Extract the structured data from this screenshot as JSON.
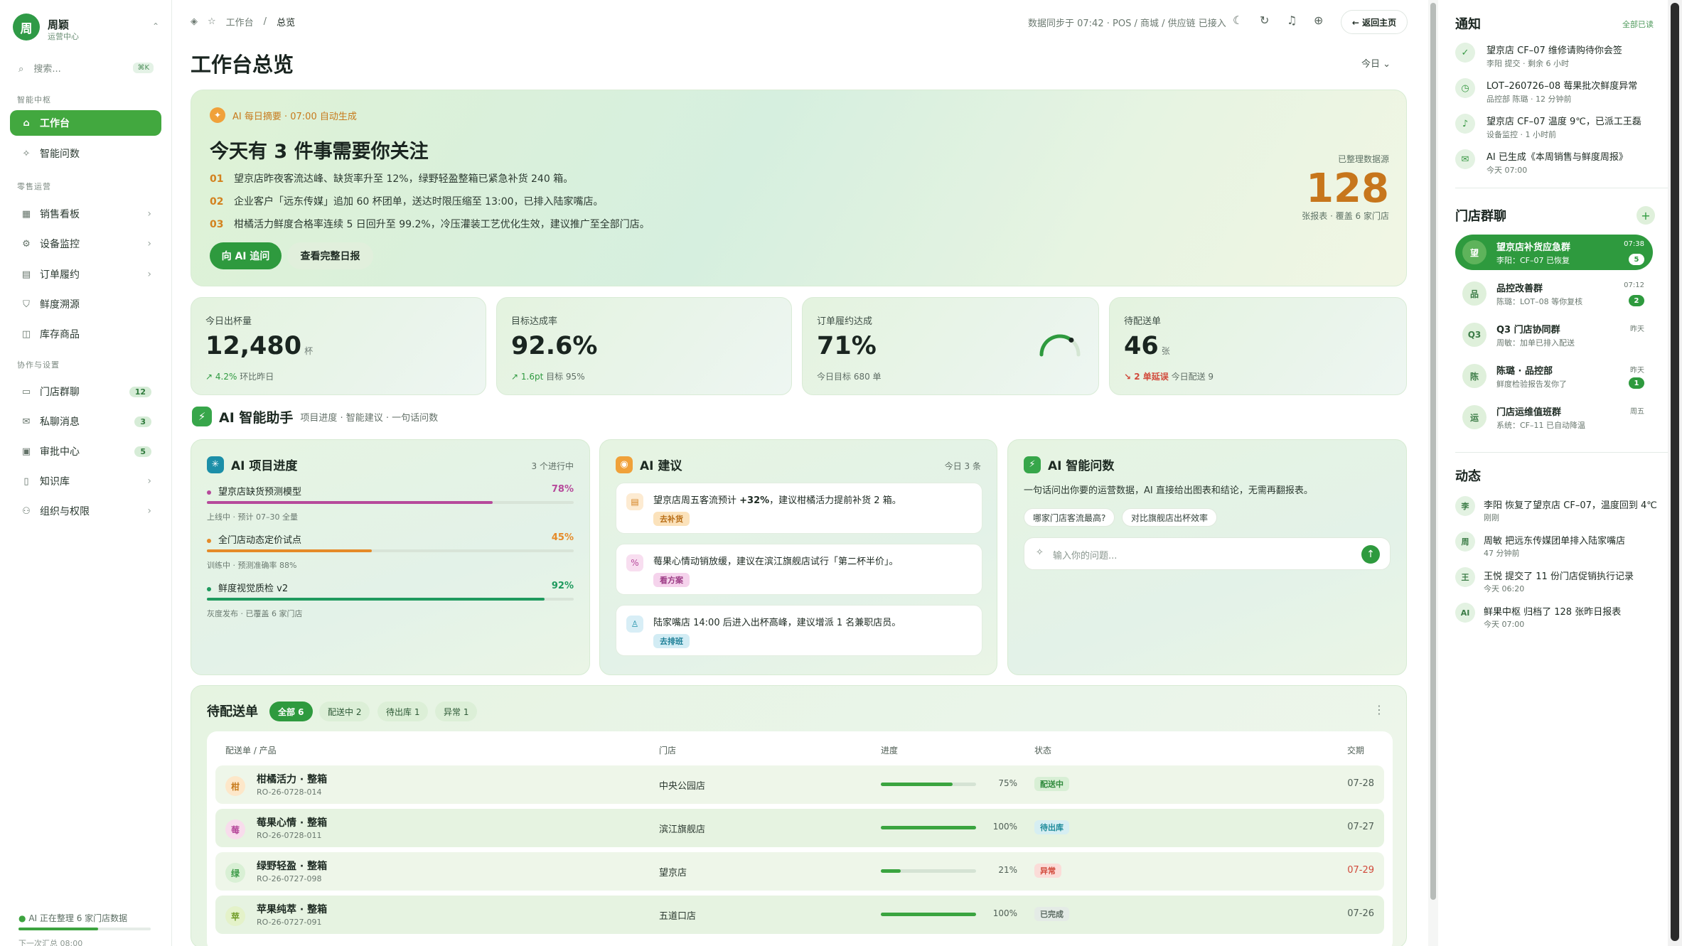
{
  "brand": {
    "avatar": "周",
    "name": "周颖",
    "role": "运营中心"
  },
  "search": {
    "placeholder": "搜索...",
    "shortcut": "⌘K"
  },
  "sections": {
    "smart": "智能中枢",
    "retail": "零售运营",
    "collab": "协作与设置"
  },
  "nav": [
    {
      "label": "工作台",
      "icon": "home-icon",
      "active": true
    },
    {
      "label": "智能问数",
      "icon": "sparkle-icon"
    },
    {
      "label": "销售看板",
      "icon": "board-icon",
      "chevron": true
    },
    {
      "label": "设备监控",
      "icon": "device-icon",
      "chevron": true
    },
    {
      "label": "订单履约",
      "icon": "receipt-icon",
      "chevron": true
    },
    {
      "label": "鲜度溯源",
      "icon": "shield-icon"
    },
    {
      "label": "库存商品",
      "icon": "box-icon"
    },
    {
      "label": "门店群聊",
      "icon": "chat-icon",
      "badge": "12"
    },
    {
      "label": "私聊消息",
      "icon": "mail-icon",
      "badge": "3"
    },
    {
      "label": "审批中心",
      "icon": "clipboard-icon",
      "badge": "5"
    },
    {
      "label": "知识库",
      "icon": "book-icon",
      "chevron": true
    },
    {
      "label": "组织与权限",
      "icon": "people-icon",
      "chevron": true
    }
  ],
  "sidebar_footer": {
    "status": "AI 正在整理 6 家门店数据",
    "sub": "下一次汇总 08:00",
    "progress": 0.6
  },
  "breadcrumb": {
    "root": "工作台",
    "sep": "/",
    "current": "总览"
  },
  "topbar": {
    "sync": "数据同步于 07:42 · POS / 商城 / 供应链 已接入",
    "back": "← 返回主页"
  },
  "page_title": "工作台总览",
  "range": "今日  ⌄",
  "hero": {
    "tag": "AI 每日摘要 · 07:00 自动生成",
    "title": "今天有 3 件事需要你关注",
    "items": [
      {
        "n": "01",
        "text": "望京店昨夜客流达峰、缺货率升至 12%，绿野轻盈整箱已紧急补货 240 箱。"
      },
      {
        "n": "02",
        "text": "企业客户「远东传媒」追加 60 杯团单，送达时限压缩至 13:00，已排入陆家嘴店。"
      },
      {
        "n": "03",
        "text": "柑橘活力鲜度合格率连续 5 日回升至 99.2%，冷压灌装工艺优化生效，建议推广至全部门店。"
      }
    ],
    "btn_ask": "向 AI 追问",
    "btn_daily": "查看完整日报",
    "stat_label": "已整理数据源",
    "stat_value": "128",
    "stat_sub": "张报表 · 覆盖 6 家门店"
  },
  "kpis": [
    {
      "label": "今日出杯量",
      "value": "12,480",
      "unit": "杯",
      "trend": "↗ 4.2%",
      "trend_sub": "环比昨日"
    },
    {
      "label": "目标达成率",
      "value": "92.6%",
      "unit": "",
      "trend": "↗ 1.6pt",
      "trend_sub": "目标 95%"
    },
    {
      "label": "订单履约达成",
      "value": "71%",
      "unit": "",
      "trend": "",
      "trend_sub": "今日目标 680 单",
      "gauge": 0.71
    },
    {
      "label": "待配送单",
      "value": "46",
      "unit": "张",
      "trend": "↘ 2 单延误",
      "trend_sub": "今日配送 9"
    }
  ],
  "assistant": {
    "title": "AI 智能助手",
    "sub": "项目进度 · 智能建议 · 一句话问数"
  },
  "progress_card": {
    "title": "AI 项目进度",
    "tag": "3 个进行中",
    "items": [
      {
        "name": "望京店缺货预测模型",
        "pct": "78%",
        "value": 0.78,
        "color": "#b64a9b",
        "detail": "上线中 · 预计 07–30 全量"
      },
      {
        "name": "全门店动态定价试点",
        "pct": "45%",
        "value": 0.45,
        "color": "#e58a28",
        "detail": "训练中 · 预测准确率 88%"
      },
      {
        "name": "鲜度视觉质检 v2",
        "pct": "92%",
        "value": 0.92,
        "color": "#1f9a5e",
        "detail": "灰度发布 · 已覆盖 6 家门店"
      }
    ]
  },
  "suggest_card": {
    "title": "AI 建议",
    "tag": "今日 3 条",
    "items": [
      {
        "pre": "望京店周五客流预计 ",
        "strong": "+32%",
        "post": "，建议柑橘活力提前补货 2 箱。",
        "btn": "去补货",
        "icon": "box-icon",
        "glyph": "▤"
      },
      {
        "pre": "莓果心情动销放缓，建议在滨江旗舰店试行「第二杯半价」。",
        "strong": "",
        "post": "",
        "btn": "看方案",
        "icon": "percent-icon",
        "glyph": "%"
      },
      {
        "pre": "陆家嘴店 14:00 后进入出杯高峰，建议增派 1 名兼职店员。",
        "strong": "",
        "post": "",
        "btn": "去排班",
        "icon": "person-icon",
        "glyph": "♙"
      }
    ]
  },
  "qa_card": {
    "title": "AI 智能问数",
    "desc": "一句话问出你要的运营数据，AI 直接给出图表和结论，无需再翻报表。",
    "chips": [
      "哪家门店客流最高?",
      "对比旗舰店出杯效率"
    ],
    "placeholder": "输入你的问题..."
  },
  "orders": {
    "title": "待配送单",
    "filters": [
      "全部 6",
      "配送中 2",
      "待出库 1",
      "异常 1"
    ],
    "columns": {
      "product": "配送单 / 产品",
      "store": "门店",
      "progress": "进度",
      "status": "状态",
      "due": "交期"
    },
    "rows": [
      {
        "icon": "柑",
        "name": "柑橘活力 · 整箱",
        "id": "RO-26-0728-014",
        "store": "中央公园店",
        "pct": "75%",
        "value": 0.75,
        "status": "配送中",
        "due": "07-28"
      },
      {
        "icon": "莓",
        "name": "莓果心情 · 整箱",
        "id": "RO-26-0728-011",
        "store": "滨江旗舰店",
        "pct": "100%",
        "value": 1.0,
        "status": "待出库",
        "due": "07-27"
      },
      {
        "icon": "绿",
        "name": "绿野轻盈 · 整箱",
        "id": "RO-26-0727-098",
        "store": "望京店",
        "pct": "21%",
        "value": 0.21,
        "status": "异常",
        "due": "07-29"
      },
      {
        "icon": "苹",
        "name": "苹果纯萃 · 整箱",
        "id": "RO-26-0727-091",
        "store": "五道口店",
        "pct": "100%",
        "value": 1.0,
        "status": "已完成",
        "due": "07-26"
      }
    ]
  },
  "notifications": {
    "title": "通知",
    "mark_all": "全部已读",
    "items": [
      {
        "title": "望京店 CF–07 维修请购待你会签",
        "sub": "李阳 提交 · 剩余 6 小时",
        "icon": "check-icon",
        "glyph": "✓"
      },
      {
        "title": "LOT–260726–08 莓果批次鲜度异常",
        "sub": "品控部 陈璐 · 12 分钟前",
        "icon": "clock-icon",
        "glyph": "◷"
      },
      {
        "title": "望京店 CF–07 温度 9℃，已派工王磊",
        "sub": "设备监控 · 1 小时前",
        "icon": "bell-icon",
        "glyph": "♪"
      },
      {
        "title": "AI 已生成《本周销售与鲜度周报》",
        "sub": "今天 07:00",
        "icon": "mail-icon",
        "glyph": "✉"
      }
    ]
  },
  "chats": {
    "title": "门店群聊",
    "add": "+",
    "items": [
      {
        "avatar": "望",
        "name": "望京店补货应急群",
        "msg": "李阳：CF–07 已恢复",
        "time": "07:38",
        "badge": "5",
        "active": true
      },
      {
        "avatar": "品",
        "name": "品控改善群",
        "msg": "陈璐：LOT–08 等你复核",
        "time": "07:12",
        "badge": "2"
      },
      {
        "avatar": "Q3",
        "name": "Q3 门店协同群",
        "msg": "周敏：加单已排入配送",
        "time": "昨天",
        "badge": ""
      },
      {
        "avatar": "陈",
        "name": "陈璐 · 品控部",
        "msg": "鲜度检验报告发你了",
        "time": "昨天",
        "badge": "1"
      },
      {
        "avatar": "运",
        "name": "门店运维值班群",
        "msg": "系统：CF–11 已自动降温",
        "time": "周五",
        "badge": ""
      }
    ]
  },
  "activity": {
    "title": "动态",
    "items": [
      {
        "avatar": "李",
        "text": "李阳 恢复了望京店 CF–07，温度回到 4℃",
        "time": "刚刚"
      },
      {
        "avatar": "周",
        "text": "周敏 把远东传媒团单排入陆家嘴店",
        "time": "47 分钟前"
      },
      {
        "avatar": "王",
        "text": "王悦 提交了 11 份门店促销执行记录",
        "time": "今天 06:20"
      },
      {
        "avatar": "AI",
        "text": "鲜果中枢 归档了 128 张昨日报表",
        "time": "今天 07:00"
      }
    ]
  },
  "colors": {
    "accent": "#2e9a3e",
    "warn": "#d3821f",
    "danger": "#d14a3b"
  }
}
